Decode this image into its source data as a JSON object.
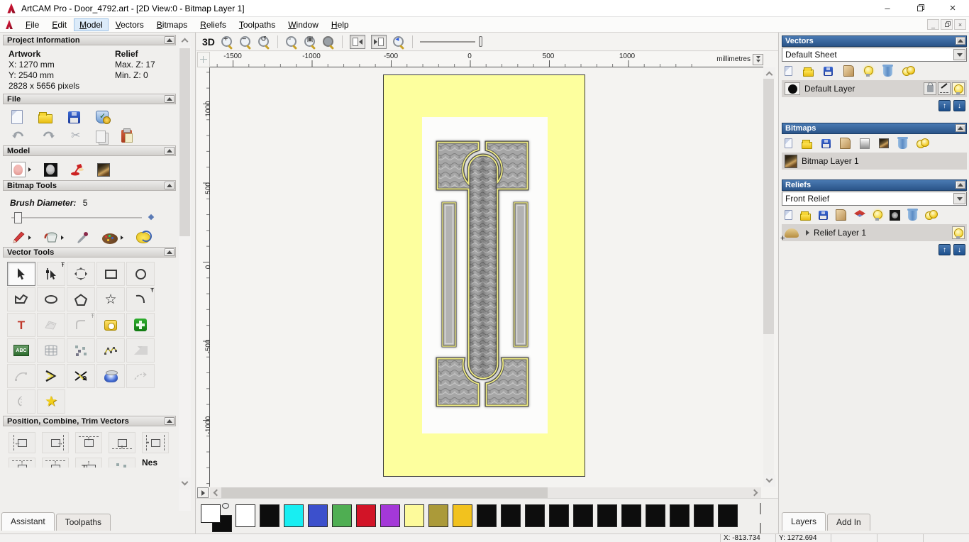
{
  "window": {
    "title": "ArtCAM Pro - Door_4792.art - [2D View:0 - Bitmap Layer 1]"
  },
  "menu": {
    "items": [
      "File",
      "Edit",
      "Model",
      "Vectors",
      "Bitmaps",
      "Reliefs",
      "Toolpaths",
      "Window",
      "Help"
    ],
    "active_item": "Model"
  },
  "assistant": {
    "project_information": {
      "title": "Project Information",
      "artwork_heading": "Artwork",
      "artwork_x": "X: 1270 mm",
      "artwork_y": "Y: 2540 mm",
      "artwork_pixels": "2828 x 5656 pixels",
      "relief_heading": "Relief",
      "relief_max_z": "Max. Z: 17",
      "relief_min_z": "Min. Z: 0"
    },
    "file_section": {
      "title": "File",
      "icons_row1": [
        "new-model",
        "open-model",
        "save-model",
        "model-properties"
      ],
      "icons_row2": [
        "undo",
        "redo",
        "cut",
        "copy",
        "paste"
      ]
    },
    "model_section": {
      "title": "Model",
      "icons": [
        "set-model-size",
        "adjust-model",
        "lighting",
        "load-bitmap"
      ]
    },
    "bitmap_tools": {
      "title": "Bitmap Tools",
      "brush_diameter_label": "Brush Diameter:",
      "brush_diameter_value": "5",
      "icons": [
        "paint-brush",
        "flood-fill",
        "colour-picker",
        "colour-palette",
        "eraser"
      ]
    },
    "vector_tools": {
      "title": "Vector Tools",
      "icons": [
        "select-vectors",
        "node-editing",
        "transform-vectors",
        "create-rectangle",
        "create-circle",
        "create-polyline",
        "create-ellipse",
        "create-polygon",
        "create-star",
        "create-arc",
        "create-text",
        "offset-vectors",
        "fillet-vectors",
        "measure-tool",
        "vector-doctor",
        "text-on-curve",
        "envelope-distort",
        "block-copy",
        "fit-polyline",
        "fit-vectors",
        "fit-arcs",
        "join-vectors",
        "trim-vectors",
        "spin-vectors",
        "extend-vectors",
        "mirror-vectors",
        "wrap-vectors"
      ]
    },
    "position_section": {
      "title": "Position, Combine, Trim Vectors",
      "nest_label": "Nes",
      "icons_row1": [
        "align-left",
        "align-right",
        "align-top",
        "align-bottom",
        "align-centre"
      ],
      "icons_row2": [
        "align-top-2",
        "align-top-3",
        "align-top-4",
        "paste-array",
        "nesting"
      ]
    },
    "tabs": {
      "assistant": "Assistant",
      "toolpaths": "Toolpaths"
    }
  },
  "canvas": {
    "toolbar": {
      "view_3d_label": "3D",
      "icons": [
        "zoom-in",
        "zoom-out",
        "zoom-previous",
        "zoom-objects",
        "zoom-page",
        "zoom-selected",
        "snap-left",
        "snap-right",
        "pan-zoom",
        "zoom-slider"
      ]
    },
    "h_ruler_labels": [
      "-1500",
      "-1000",
      "-500",
      "0",
      "500",
      "1000"
    ],
    "v_ruler_labels": [
      "1000",
      "500",
      "0",
      "-500",
      "-1000"
    ],
    "ruler_units": "millimetres"
  },
  "layers_panel": {
    "vectors": {
      "title": "Vectors",
      "sheet_value": "Default Sheet",
      "toolbar_icons": [
        "new-layer",
        "open-layer",
        "save-layer",
        "merge-layers",
        "toggle-visibility",
        "delete-layer",
        "all-layers-visibility"
      ],
      "layer_name": "Default Layer",
      "layer_buttons": [
        "lock-layer",
        "snap-layer",
        "layer-visibility"
      ]
    },
    "bitmaps": {
      "title": "Bitmaps",
      "toolbar_icons": [
        "new-layer",
        "open-layer",
        "save-layer",
        "merge-layers",
        "greyscale-view",
        "colour-view",
        "delete-layer",
        "all-layers-visibility"
      ],
      "layer_name": "Bitmap Layer 1"
    },
    "reliefs": {
      "title": "Reliefs",
      "relief_value": "Front Relief",
      "toolbar_icons": [
        "new-layer",
        "open-layer",
        "save-layer",
        "merge-layers",
        "combine-relief",
        "toggle-visibility",
        "greyscale-preview",
        "delete-layer",
        "all-layers-visibility"
      ],
      "layer_name": "Relief Layer 1"
    },
    "tabs": {
      "layers": "Layers",
      "add_in": "Add In"
    }
  },
  "palette": {
    "colors": [
      "#ffffff",
      "#0d0d0d",
      "#18eef2",
      "#3c50cc",
      "#4fae52",
      "#d21427",
      "#a438d8",
      "#fdfa9b",
      "#ab9a39",
      "#f2c21e",
      "#0d0d0d",
      "#0d0d0d",
      "#0d0d0d",
      "#0d0d0d",
      "#0d0d0d",
      "#0d0d0d",
      "#0d0d0d",
      "#0d0d0d",
      "#0d0d0d",
      "#0d0d0d",
      "#0d0d0d"
    ],
    "primary_color": "#ffffff",
    "secondary_color": "#0d0d0d"
  },
  "status_bar": {
    "x": "X: -813.734",
    "y": "Y: 1272.694"
  }
}
